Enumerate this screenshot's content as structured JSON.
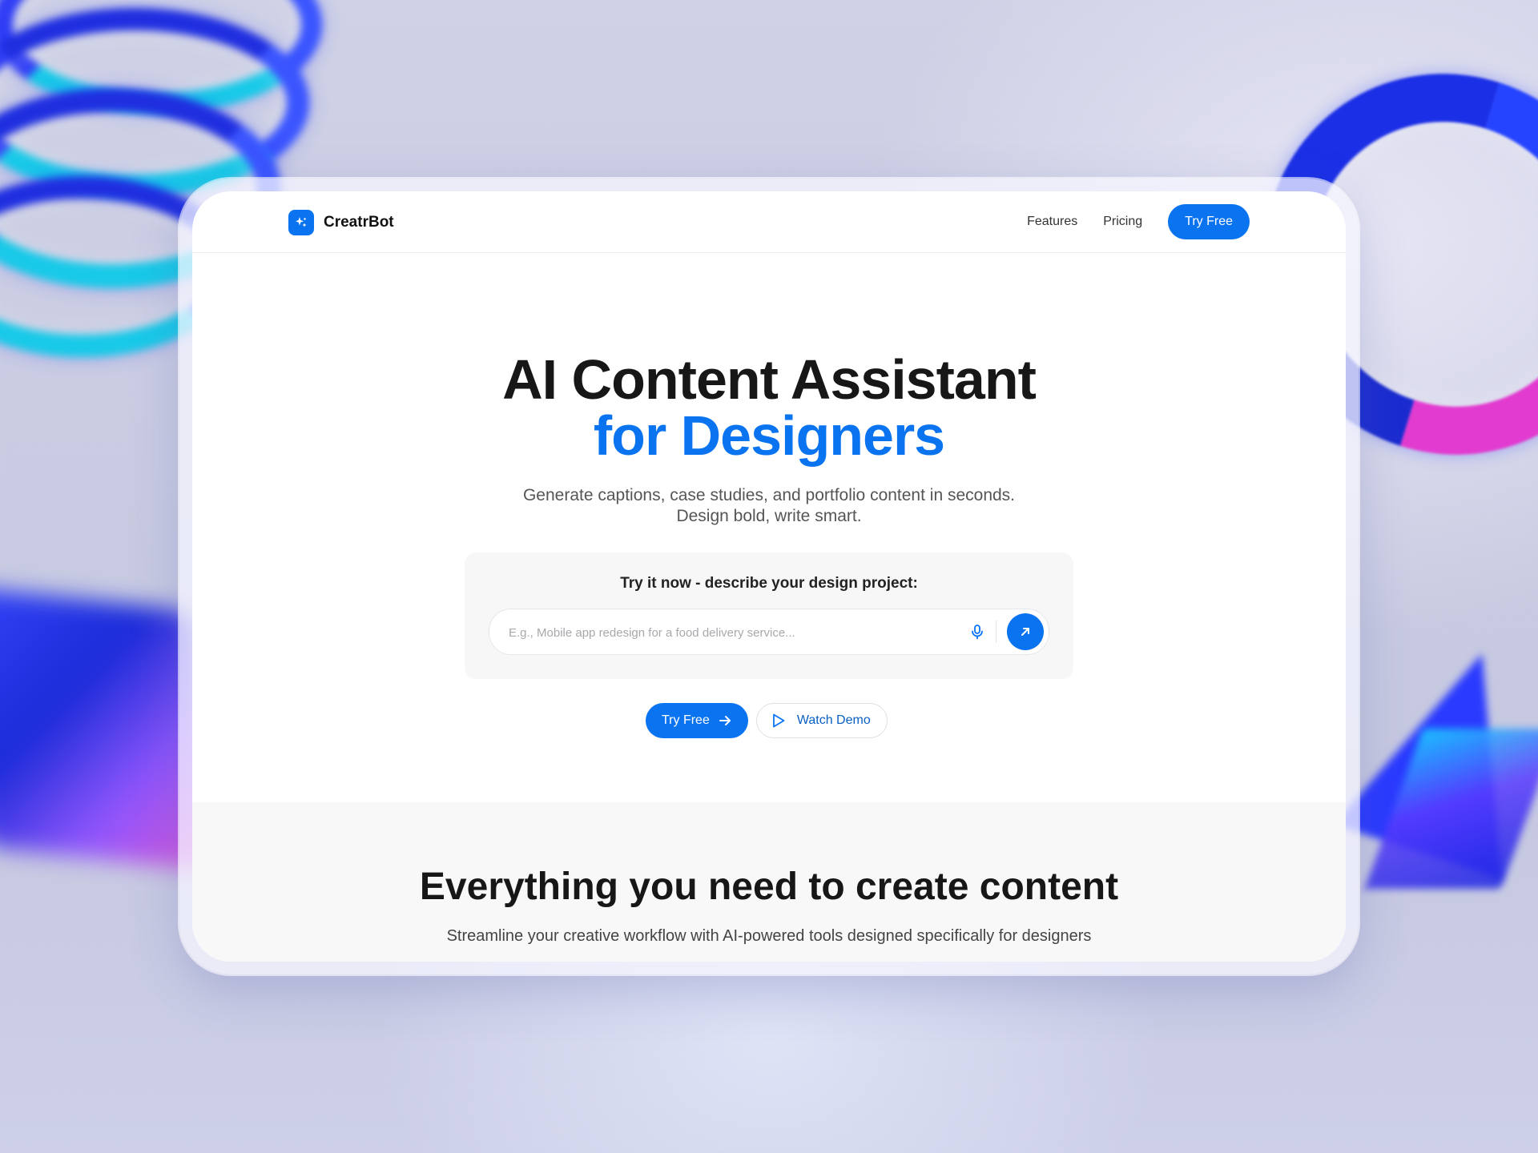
{
  "brand": {
    "name": "CreatrBot",
    "logo_icon": "sparkle-icon",
    "accent_color": "#0a74f0"
  },
  "nav": {
    "links": [
      "Features",
      "Pricing"
    ],
    "cta_label": "Try Free"
  },
  "hero": {
    "title_line1": "AI Content Assistant",
    "title_line2": "for Designers",
    "subtitle_line1": "Generate captions, case studies, and portfolio content in seconds.",
    "subtitle_line2": "Design bold, write smart."
  },
  "try_box": {
    "label": "Try it now - describe your design project:",
    "placeholder": "E.g., Mobile app redesign for a food delivery service...",
    "value": "",
    "mic_icon": "microphone-icon",
    "send_icon": "arrow-up-right-icon"
  },
  "cta": {
    "try_label": "Try Free",
    "try_icon": "arrow-right-icon",
    "demo_label": "Watch Demo",
    "demo_icon": "play-icon"
  },
  "features": {
    "title": "Everything you need to create content",
    "subtitle": "Streamline your creative workflow with AI-powered tools designed specifically for designers"
  }
}
